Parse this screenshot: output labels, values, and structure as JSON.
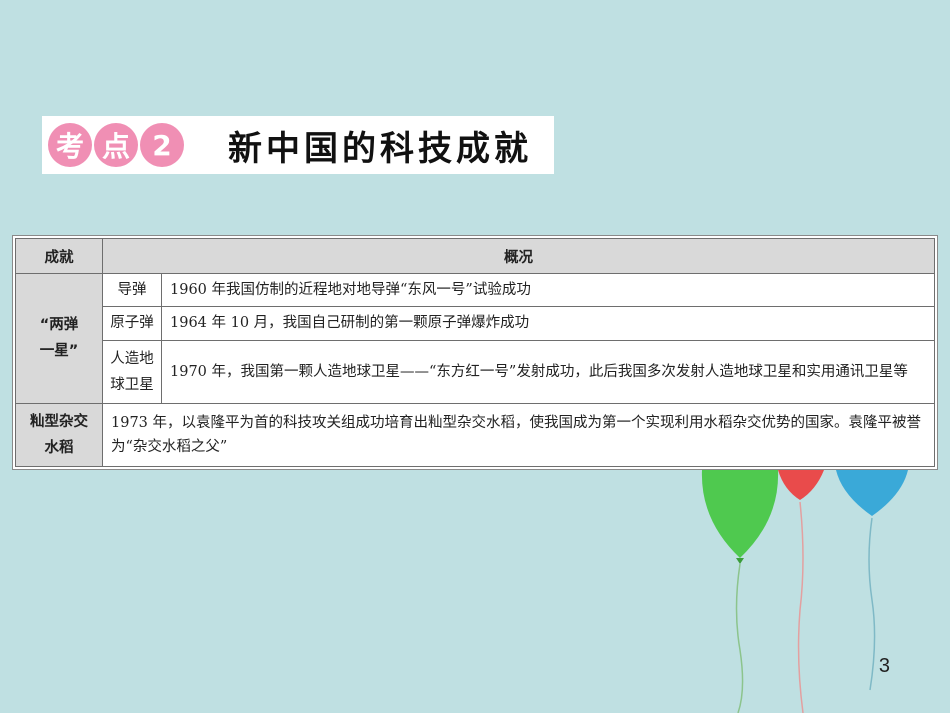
{
  "banner": {
    "char1": "考",
    "char2": "点",
    "num": "2",
    "title": "新中国的科技成就"
  },
  "table": {
    "header": {
      "col1": "成就",
      "col2": "概况"
    },
    "group1": {
      "name_line1": "“两弹",
      "name_line2": "一星”",
      "rows": [
        {
          "sub": "导弹",
          "desc": "1960 年我国仿制的近程地对地导弹“东风一号”试验成功"
        },
        {
          "sub": "原子弹",
          "desc": "1964 年 10 月，我国自己研制的第一颗原子弹爆炸成功"
        },
        {
          "sub_line1": "人造地",
          "sub_line2": "球卫星",
          "desc": "1970 年，我国第一颗人造地球卫星——“东方红一号”发射成功，此后我国多次发射人造地球卫星和实用通讯卫星等"
        }
      ]
    },
    "row_rice": {
      "name_line1": "籼型杂交",
      "name_line2": "水稻",
      "desc": "1973 年，以袁隆平为首的科技攻关组成功培育出籼型杂交水稻，使我国成为第一个实现利用水稻杂交优势的国家。袁隆平被誉为“杂交水稻之父”"
    }
  },
  "balloons": [
    {
      "name": "green",
      "color": "#4fc94f"
    },
    {
      "name": "red",
      "color": "#e94b4b"
    },
    {
      "name": "blue",
      "color": "#3aa9d8"
    }
  ],
  "page_number": "3"
}
